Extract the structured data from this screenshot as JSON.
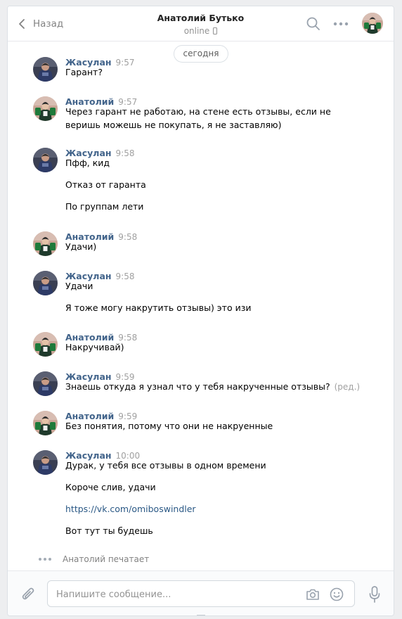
{
  "header": {
    "back_label": "Назад",
    "title": "Анатолий Бутько",
    "status": "online",
    "status_icon": "mobile-phone-icon"
  },
  "date_label": "сегодня",
  "messages": [
    {
      "author": "Жасулан",
      "time": "9:57",
      "lines": [
        "Гарант?"
      ]
    },
    {
      "author": "Анатолий",
      "time": "9:57",
      "lines": [
        "Через гарант не работаю, на стене есть отзывы, если не",
        "веришь можешь не покупать, я не заставляю)"
      ]
    },
    {
      "author": "Жасулан",
      "time": "9:58",
      "lines": [
        "Пфф, кид",
        "Отказ от гаранта",
        "По группам лети"
      ]
    },
    {
      "author": "Анатолий",
      "time": "9:58",
      "lines": [
        "Удачи)"
      ]
    },
    {
      "author": "Жасулан",
      "time": "9:58",
      "lines": [
        "Удачи",
        "Я тоже могу накрутить отзывы) это изи"
      ]
    },
    {
      "author": "Анатолий",
      "time": "9:58",
      "lines": [
        "Накручивай)"
      ]
    },
    {
      "author": "Жасулан",
      "time": "9:59",
      "lines": [
        "Знаешь откуда я узнал что у тебя накрученные отзывы?"
      ],
      "edited": "(ред.)"
    },
    {
      "author": "Анатолий",
      "time": "9:59",
      "lines": [
        "Без понятия, потому что они не накруенные"
      ]
    },
    {
      "author": "Жасулан",
      "time": "10:00",
      "lines": [
        "Дурак, у тебя все отзывы в одном времени",
        "Короче слив, удачи",
        "https://vk.com/omiboswindler",
        "Вот тут ты будешь"
      ]
    }
  ],
  "typing": "Анатолий печатает",
  "composer": {
    "placeholder": "Напишите сообщение...",
    "value": ""
  },
  "colors": {
    "author": "#42648b",
    "link": "#2a5885",
    "meta": "#a0a0a0",
    "background": "#edeef0"
  }
}
